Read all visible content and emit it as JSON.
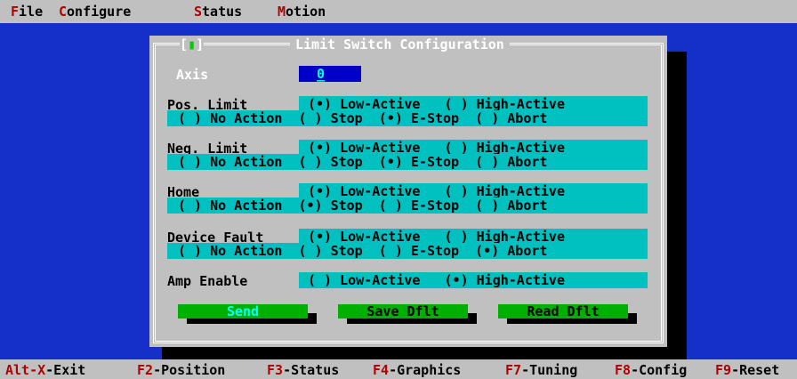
{
  "menu": {
    "file": {
      "hot": "F",
      "rest": "ile"
    },
    "configure": {
      "hot": "C",
      "rest": "onfigure"
    },
    "status": {
      "hot": "S",
      "rest": "tatus"
    },
    "motion": {
      "hot": "M",
      "rest": "otion"
    }
  },
  "dialog": {
    "title": "Limit Switch Configuration",
    "control_box": {
      "left": "[",
      "mark": "▮",
      "right": "]"
    },
    "axis": {
      "label": "Axis",
      "value": "0",
      "cursor": "_"
    },
    "pos_limit": {
      "label": "Pos. Limit",
      "polarity": "(•) Low-Active   ( ) High-Active",
      "action": "( ) No Action  ( ) Stop  (•) E-Stop  ( ) Abort"
    },
    "neg_limit": {
      "label": "Neg. Limit",
      "polarity": "(•) Low-Active   ( ) High-Active",
      "action": "( ) No Action  ( ) Stop  (•) E-Stop  ( ) Abort"
    },
    "home": {
      "label": "Home",
      "polarity": "(•) Low-Active   ( ) High-Active",
      "action": "( ) No Action  (•) Stop  ( ) E-Stop  ( ) Abort"
    },
    "device_fault": {
      "label": "Device Fault",
      "polarity": "(•) Low-Active   ( ) High-Active",
      "action": "( ) No Action  ( ) Stop  ( ) E-Stop  (•) Abort"
    },
    "amp_enable": {
      "label": "Amp Enable",
      "polarity": "( ) Low-Active   (•) High-Active"
    },
    "buttons": {
      "send": "Send",
      "save": "Save Dflt",
      "read": "Read Dflt"
    }
  },
  "statusbar": {
    "alt_x": {
      "hot": "Alt-X",
      "rest": "-Exit"
    },
    "f2": {
      "hot": "F2",
      "rest": "-Position"
    },
    "f3": {
      "hot": "F3",
      "rest": "-Status"
    },
    "f4": {
      "hot": "F4",
      "rest": "-Graphics"
    },
    "f7": {
      "hot": "F7",
      "rest": "-Tuning"
    },
    "f8": {
      "hot": "F8",
      "rest": "-Config"
    },
    "f9": {
      "hot": "F9",
      "rest": "-Reset"
    }
  },
  "colors": {
    "desktop": "#1430c8",
    "menu_bg": "#c0c0c0",
    "hotkey": "#b00000",
    "field_bg": "#00c0c0",
    "button_bg": "#00b000",
    "focus_text": "#00ffff"
  }
}
